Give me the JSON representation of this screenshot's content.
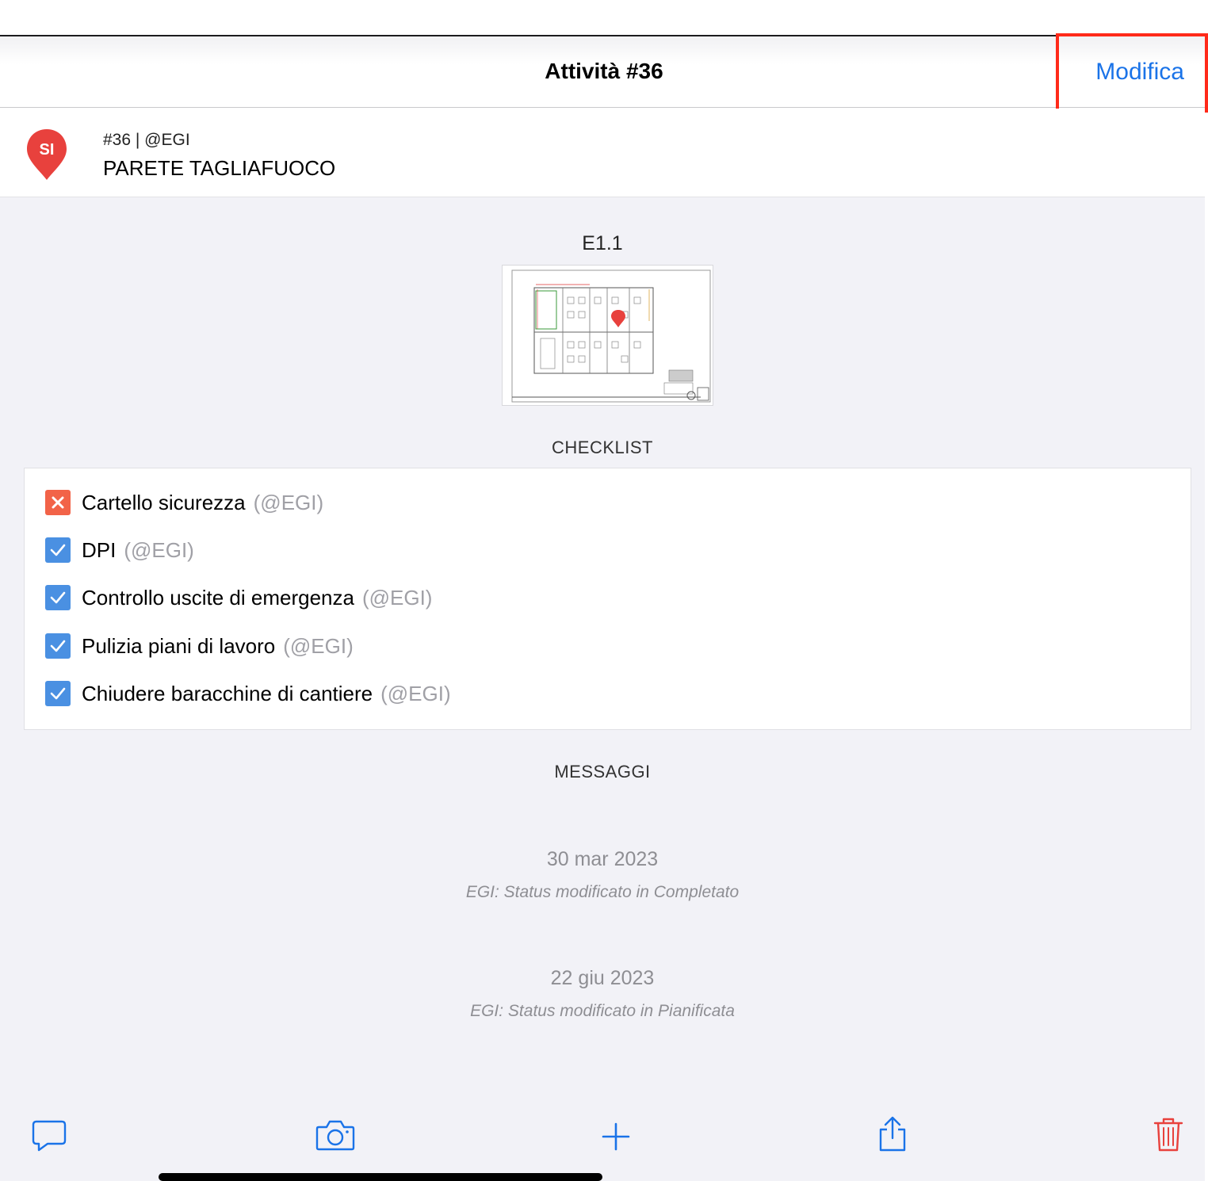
{
  "nav": {
    "title": "Attività #36",
    "edit_label": "Modifica"
  },
  "task": {
    "pin_label": "SI",
    "meta": "#36 | @EGI",
    "name": "PARETE TAGLIAFUOCO"
  },
  "plan": {
    "label": "E1.1"
  },
  "checklist": {
    "title": "CHECKLIST",
    "items": [
      {
        "text": "Cartello sicurezza",
        "user": "(@EGI)",
        "status": "failed"
      },
      {
        "text": "DPI",
        "user": "(@EGI)",
        "status": "done"
      },
      {
        "text": "Controllo uscite di emergenza",
        "user": "(@EGI)",
        "status": "done"
      },
      {
        "text": "Pulizia piani di lavoro",
        "user": "(@EGI)",
        "status": "done"
      },
      {
        "text": "Chiudere baracchine di cantiere",
        "user": "(@EGI)",
        "status": "done"
      }
    ]
  },
  "messages": {
    "title": "MESSAGGI",
    "items": [
      {
        "date": "30 mar 2023",
        "text": "EGI: Status modificato in Completato"
      },
      {
        "date": "22 giu 2023",
        "text": "EGI: Status modificato in Pianificata"
      }
    ]
  },
  "toolbar": {
    "icons": [
      "comment-icon",
      "camera-icon",
      "plus-icon",
      "share-icon",
      "trash-icon"
    ]
  },
  "colors": {
    "accent": "#1a73e8",
    "pin": "#e8413d",
    "check_done": "#4a90e2",
    "check_fail": "#f26348",
    "delete": "#e8413d"
  }
}
